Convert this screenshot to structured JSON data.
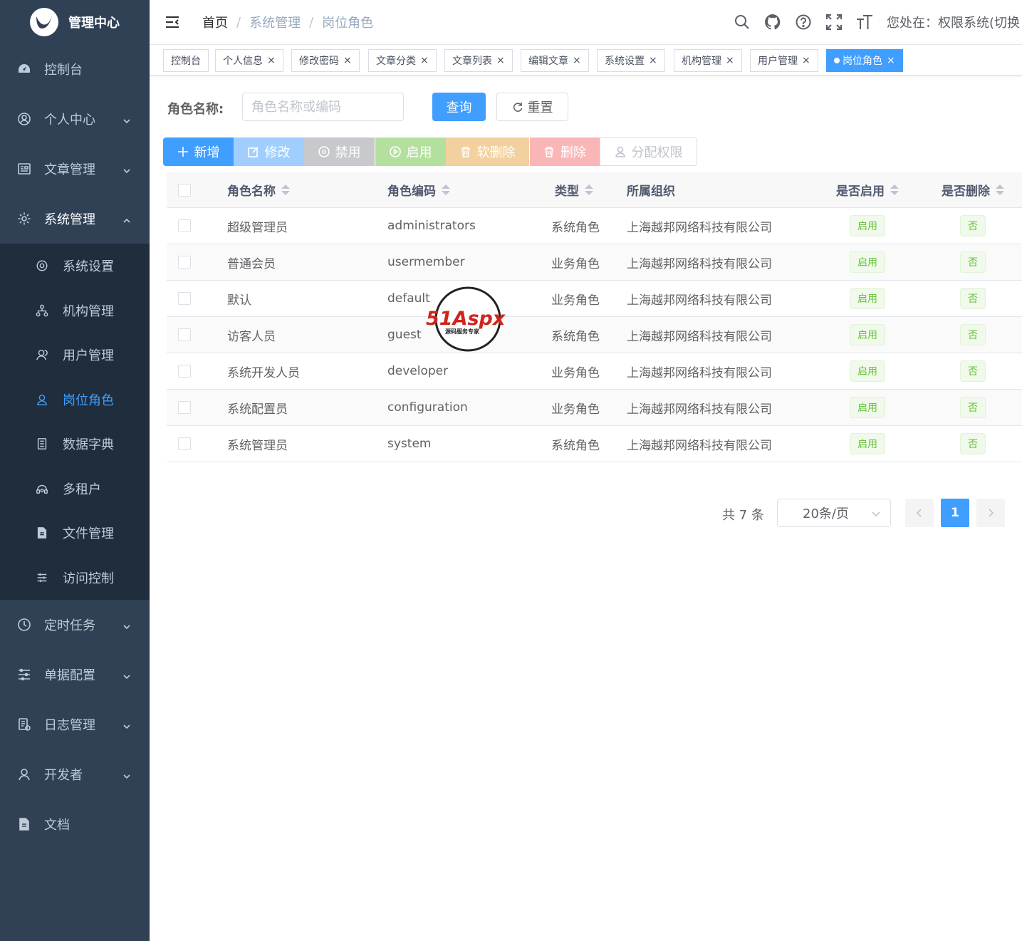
{
  "app": {
    "title": "管理中心"
  },
  "sidebar": {
    "items": [
      {
        "label": "控制台",
        "icon": "dashboard-icon"
      },
      {
        "label": "个人中心",
        "icon": "user-circle-icon"
      },
      {
        "label": "文章管理",
        "icon": "article-icon"
      },
      {
        "label": "系统管理",
        "icon": "gear-icon"
      },
      {
        "label": "定时任务",
        "icon": "clock-icon"
      },
      {
        "label": "单据配置",
        "icon": "list-config-icon"
      },
      {
        "label": "日志管理",
        "icon": "log-icon"
      },
      {
        "label": "开发者",
        "icon": "developer-icon"
      },
      {
        "label": "文档",
        "icon": "document-icon"
      }
    ],
    "sub_items": [
      {
        "label": "系统设置",
        "icon": "gear-icon"
      },
      {
        "label": "机构管理",
        "icon": "tree-icon"
      },
      {
        "label": "用户管理",
        "icon": "users-icon"
      },
      {
        "label": "岗位角色",
        "icon": "user-icon"
      },
      {
        "label": "数据字典",
        "icon": "dictionary-icon"
      },
      {
        "label": "多租户",
        "icon": "tenant-icon"
      },
      {
        "label": "文件管理",
        "icon": "file-icon"
      },
      {
        "label": "访问控制",
        "icon": "sliders-icon"
      }
    ]
  },
  "header": {
    "breadcrumb": [
      "首页",
      "系统管理",
      "岗位角色"
    ],
    "breadcrumb_sep": "/",
    "location": "您处在：权限系统(切换"
  },
  "tags": [
    "控制台",
    "个人信息",
    "修改密码",
    "文章分类",
    "文章列表",
    "编辑文章",
    "系统设置",
    "机构管理",
    "用户管理",
    "岗位角色"
  ],
  "tag_close": "×",
  "search": {
    "label": "角色名称:",
    "placeholder": "角色名称或编码",
    "query_label": "查询",
    "reset_label": "重置"
  },
  "toolbar": {
    "add": "新增",
    "edit": "修改",
    "disable": "禁用",
    "enable": "启用",
    "soft_delete": "软删除",
    "delete": "删除",
    "assign": "分配权限"
  },
  "table": {
    "headers": {
      "name": "角色名称",
      "code": "角色编码",
      "type": "类型",
      "org": "所属组织",
      "enabled": "是否启用",
      "deleted": "是否删除"
    },
    "rows": [
      {
        "name": "超级管理员",
        "code": "administrators",
        "type": "系统角色",
        "org": "上海越邦网络科技有限公司",
        "enabled": "启用",
        "deleted": "否"
      },
      {
        "name": "普通会员",
        "code": "usermember",
        "type": "业务角色",
        "org": "上海越邦网络科技有限公司",
        "enabled": "启用",
        "deleted": "否"
      },
      {
        "name": "默认",
        "code": "default",
        "type": "业务角色",
        "org": "上海越邦网络科技有限公司",
        "enabled": "启用",
        "deleted": "否"
      },
      {
        "name": "访客人员",
        "code": "guest",
        "type": "系统角色",
        "org": "上海越邦网络科技有限公司",
        "enabled": "启用",
        "deleted": "否"
      },
      {
        "name": "系统开发人员",
        "code": "developer",
        "type": "业务角色",
        "org": "上海越邦网络科技有限公司",
        "enabled": "启用",
        "deleted": "否"
      },
      {
        "name": "系统配置员",
        "code": "configuration",
        "type": "业务角色",
        "org": "上海越邦网络科技有限公司",
        "enabled": "启用",
        "deleted": "否"
      },
      {
        "name": "系统管理员",
        "code": "system",
        "type": "系统角色",
        "org": "上海越邦网络科技有限公司",
        "enabled": "启用",
        "deleted": "否"
      }
    ]
  },
  "pagination": {
    "total": "共 7 条",
    "page_size": "20条/页",
    "current_page": "1"
  },
  "watermark": {
    "brand": "51Aspx",
    "slogan": "源码服务专家"
  },
  "colors": {
    "sidebar_bg": "#304156",
    "submenu_bg": "#1f2d3d",
    "primary": "#409eff",
    "success": "#67c23a"
  }
}
